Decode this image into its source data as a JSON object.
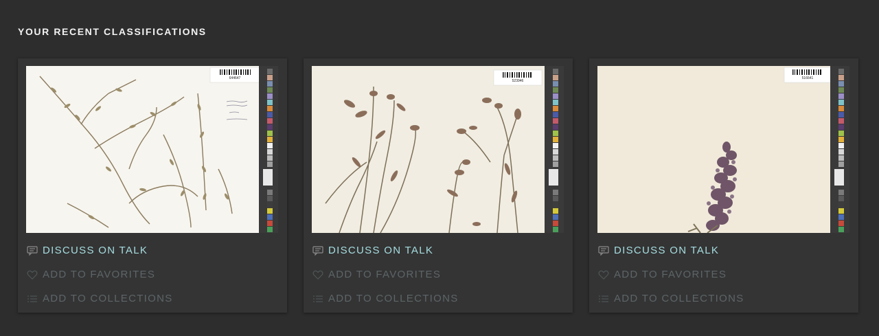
{
  "section": {
    "title": "YOUR RECENT CLASSIFICATIONS"
  },
  "cards": [
    {
      "discuss_label": "DISCUSS ON TALK",
      "favorites_label": "ADD TO FAVORITES",
      "collections_label": "ADD TO COLLECTIONS",
      "barcode_text": "644647"
    },
    {
      "discuss_label": "DISCUSS ON TALK",
      "favorites_label": "ADD TO FAVORITES",
      "collections_label": "ADD TO COLLECTIONS",
      "barcode_text": "523946"
    },
    {
      "discuss_label": "DISCUSS ON TALK",
      "favorites_label": "ADD TO FAVORITES",
      "collections_label": "ADD TO COLLECTIONS",
      "barcode_text": "516641"
    }
  ],
  "colors": {
    "talk_link": "#a6dde0",
    "muted_link": "#5d6568",
    "background": "#2d2d2d",
    "card": "#343434"
  },
  "icons": {
    "talk": "speech-bubble-icon",
    "favorites": "heart-icon",
    "collections": "list-icon"
  }
}
